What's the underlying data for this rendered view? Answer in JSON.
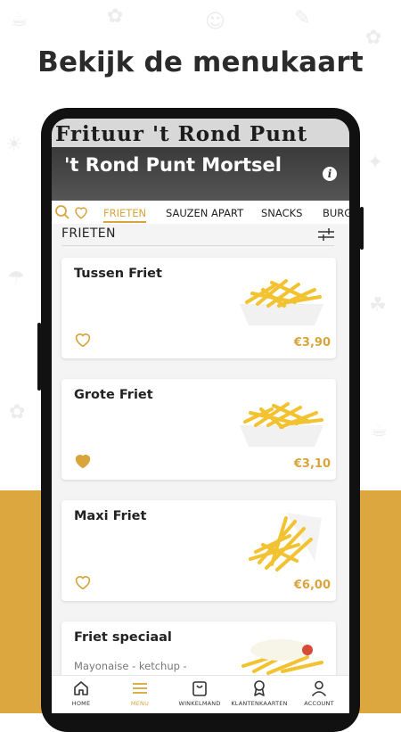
{
  "headline": "Bekijk de menukaart",
  "restaurant": {
    "sign_text": "Frituur 't Rond Punt",
    "name": "'t Rond Punt Mortsel",
    "info_icon": "info-icon"
  },
  "tabs": [
    {
      "label": "FRIETEN",
      "active": true
    },
    {
      "label": "SAUZEN APART",
      "active": false
    },
    {
      "label": "SNACKS",
      "active": false
    },
    {
      "label": "BURG",
      "active": false
    }
  ],
  "section": {
    "title": "FRIETEN",
    "filter_icon": "filter-icon"
  },
  "products": [
    {
      "name": "Tussen Friet",
      "description": "",
      "price": "€3,90",
      "favorite": false
    },
    {
      "name": "Grote Friet",
      "description": "",
      "price": "€3,10",
      "favorite": true
    },
    {
      "name": "Maxi Friet",
      "description": "",
      "price": "€6,00",
      "favorite": false
    },
    {
      "name": "Friet speciaal",
      "description": "Mayonaise - ketchup - rauwe ui",
      "price": "",
      "favorite": false
    }
  ],
  "nav": [
    {
      "label": "HOME",
      "icon": "home-icon",
      "active": false
    },
    {
      "label": "MENU",
      "icon": "menu-icon",
      "active": true
    },
    {
      "label": "WINKELMAND",
      "icon": "shopping-bag-icon",
      "active": false
    },
    {
      "label": "KLANTENKAARTEN",
      "icon": "badge-icon",
      "active": false
    },
    {
      "label": "ACCOUNT",
      "icon": "user-icon",
      "active": false
    }
  ],
  "colors": {
    "accent": "#d9a43b",
    "promo_background": "#dca73e",
    "text": "#222222"
  }
}
